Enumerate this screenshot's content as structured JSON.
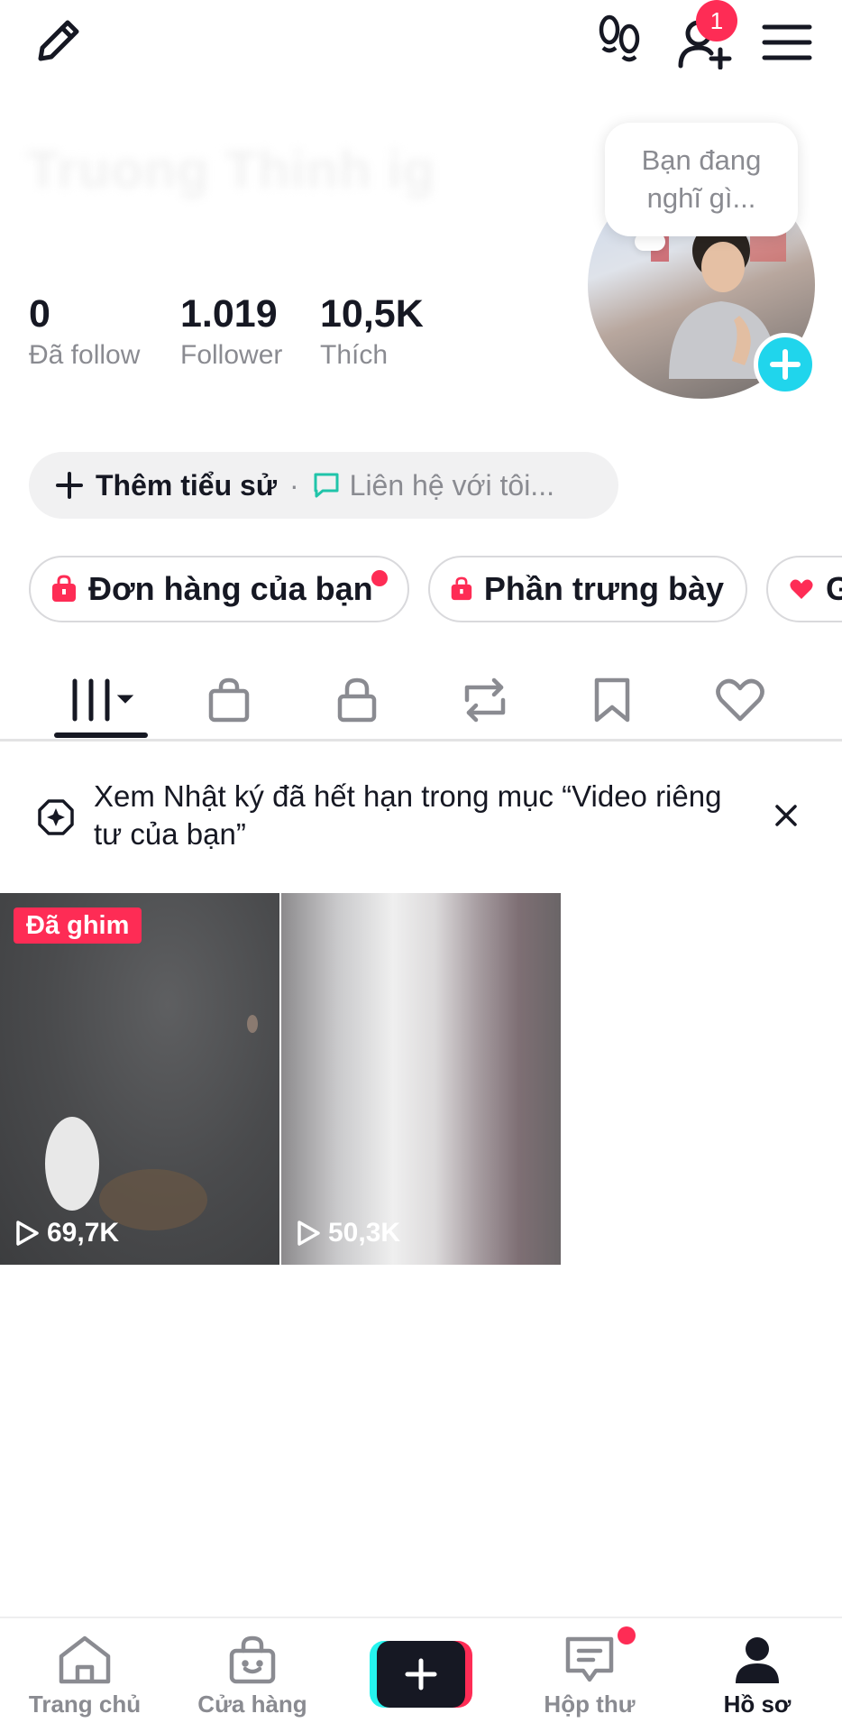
{
  "header": {
    "friends_badge_count": "1"
  },
  "profile": {
    "display_name": "Truong Thinh ig",
    "thought_bubble": {
      "line1": "Bạn đang",
      "line2": "nghĩ gì..."
    },
    "stats": [
      {
        "value": "0",
        "label": "Đã follow"
      },
      {
        "value": "1.019",
        "label": "Follower"
      },
      {
        "value": "10,5K",
        "label": "Thích"
      }
    ],
    "bio": {
      "add_label": "Thêm tiểu sử",
      "separator": "·",
      "contact_label": "Liên hệ với tôi..."
    }
  },
  "chips": [
    {
      "label": "Đơn hàng của bạn"
    },
    {
      "label": "Phần trưng bày"
    },
    {
      "label": "G"
    }
  ],
  "notice": {
    "text": "Xem Nhật ký đã hết hạn trong mục “Video riêng tư của bạn”"
  },
  "videos": [
    {
      "pinned_label": "Đã ghim",
      "views": "69,7K"
    },
    {
      "views": "50,3K"
    }
  ],
  "bottom_nav": {
    "home": "Trang chủ",
    "shop": "Cửa hàng",
    "inbox": "Hộp thư",
    "profile": "Hồ sơ"
  },
  "colors": {
    "accent_red": "#fe2c55",
    "accent_cyan": "#20d5ec",
    "text_primary": "#161823",
    "text_secondary": "#8a8b91"
  }
}
